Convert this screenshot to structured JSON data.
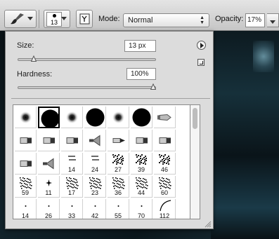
{
  "options_bar": {
    "tool_preset_icon": "brush-icon",
    "brush_preset_size": "13",
    "toggle_brush_panel_icon": "brush-panel-icon",
    "mode_label": "Mode:",
    "mode_value": "Normal",
    "opacity_label": "Opacity:",
    "opacity_value": "17%"
  },
  "brush_panel": {
    "size_label": "Size:",
    "size_value": "13 px",
    "size_slider_fraction": 0.1,
    "hardness_label": "Hardness:",
    "hardness_value": "100%",
    "hardness_slider_fraction": 1.0,
    "menu_icon": "panel-menu-icon",
    "reset_icon": "new-preset-icon",
    "columns": 7,
    "brushes": [
      {
        "kind": "soft-round",
        "label": ""
      },
      {
        "kind": "hard-round",
        "label": "",
        "selected": true
      },
      {
        "kind": "soft-round",
        "label": ""
      },
      {
        "kind": "hard-round",
        "label": ""
      },
      {
        "kind": "soft-round",
        "label": ""
      },
      {
        "kind": "hard-round",
        "label": ""
      },
      {
        "kind": "airbrush-tip",
        "label": ""
      },
      {
        "kind": "flat-tip",
        "label": ""
      },
      {
        "kind": "flat-tip",
        "label": ""
      },
      {
        "kind": "flat-tip",
        "label": ""
      },
      {
        "kind": "fan-tip",
        "label": ""
      },
      {
        "kind": "bristle-tip",
        "label": ""
      },
      {
        "kind": "flat-tip",
        "label": ""
      },
      {
        "kind": "flat-tip",
        "label": ""
      },
      {
        "kind": "flat-tip",
        "label": ""
      },
      {
        "kind": "fan-tip",
        "label": ""
      },
      {
        "kind": "scatter-small",
        "label": "14"
      },
      {
        "kind": "scatter-small",
        "label": "24"
      },
      {
        "kind": "scatter",
        "label": "27"
      },
      {
        "kind": "scatter",
        "label": "39"
      },
      {
        "kind": "scatter",
        "label": "46"
      },
      {
        "kind": "chalk",
        "label": "59"
      },
      {
        "kind": "star-small",
        "label": "11"
      },
      {
        "kind": "chalk",
        "label": "17"
      },
      {
        "kind": "chalk",
        "label": "23"
      },
      {
        "kind": "chalk",
        "label": "36"
      },
      {
        "kind": "chalk",
        "label": "44"
      },
      {
        "kind": "chalk",
        "label": "60"
      },
      {
        "kind": "dot-tiny",
        "label": "14"
      },
      {
        "kind": "dot-tiny",
        "label": "26"
      },
      {
        "kind": "dot-tiny",
        "label": "33"
      },
      {
        "kind": "dot-tiny",
        "label": "42"
      },
      {
        "kind": "dot-tiny",
        "label": "55"
      },
      {
        "kind": "dot-tiny",
        "label": "70"
      },
      {
        "kind": "arc",
        "label": "112"
      },
      {
        "kind": "dot-tiny",
        "label": ""
      },
      {
        "kind": "dot-tiny",
        "label": ""
      },
      {
        "kind": "dot-tiny",
        "label": ""
      },
      {
        "kind": "dot-tiny",
        "label": ""
      },
      {
        "kind": "dot-tiny",
        "label": ""
      },
      {
        "kind": "dot-tiny",
        "label": ""
      },
      {
        "kind": "dot-tiny",
        "label": ""
      }
    ]
  }
}
